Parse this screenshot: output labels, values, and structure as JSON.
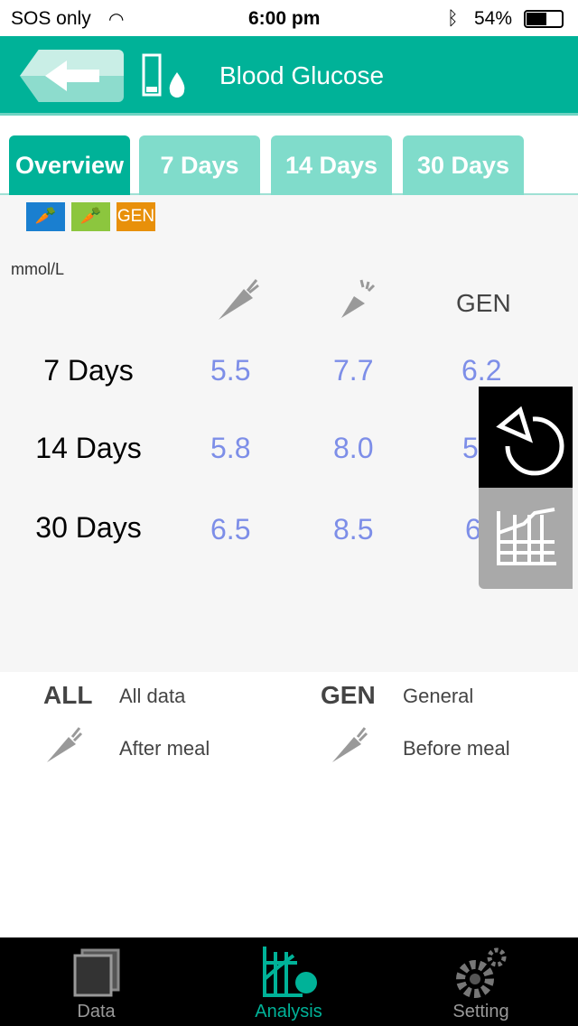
{
  "status": {
    "carrier": "SOS only",
    "time": "6:00 pm",
    "battery": "54%"
  },
  "header": {
    "title": "Blood Glucose",
    "back_icon": "back-arrow-icon",
    "device_icon": "test-strip-drop-icon"
  },
  "tabs": [
    {
      "label": "Overview",
      "active": true
    },
    {
      "label": "7 Days"
    },
    {
      "label": "14 Days"
    },
    {
      "label": "30 Days"
    }
  ],
  "badges": [
    {
      "icon": "after-meal-carrot-icon",
      "color": "#1a7fd0"
    },
    {
      "icon": "before-meal-carrot-icon",
      "color": "#8cc63e"
    },
    {
      "label": "GEN",
      "color": "#e8900a"
    }
  ],
  "table": {
    "unit": "mmol/L",
    "columns": [
      "after-meal",
      "before-meal",
      "GEN"
    ],
    "rows": [
      {
        "label": "7 Days",
        "values": [
          "5.5",
          "7.7",
          "6.2"
        ]
      },
      {
        "label": "14 Days",
        "values": [
          "5.8",
          "8.0",
          "5"
        ]
      },
      {
        "label": "30 Days",
        "values": [
          "6.5",
          "8.5",
          "6.1"
        ]
      }
    ]
  },
  "legend": [
    {
      "key": "ALL",
      "text": "All data"
    },
    {
      "key": "GEN",
      "text": "General"
    },
    {
      "icon": "after-meal-carrot-icon",
      "text": "After meal"
    },
    {
      "icon": "before-meal-carrot-icon",
      "text": "Before meal"
    }
  ],
  "tabbar": [
    {
      "label": "Data",
      "icon": "data-icon"
    },
    {
      "label": "Analysis",
      "icon": "analysis-icon",
      "active": true
    },
    {
      "label": "Setting",
      "icon": "gear-icon"
    }
  ],
  "colors": {
    "primary": "#00b298",
    "value": "#7d8ee8"
  }
}
